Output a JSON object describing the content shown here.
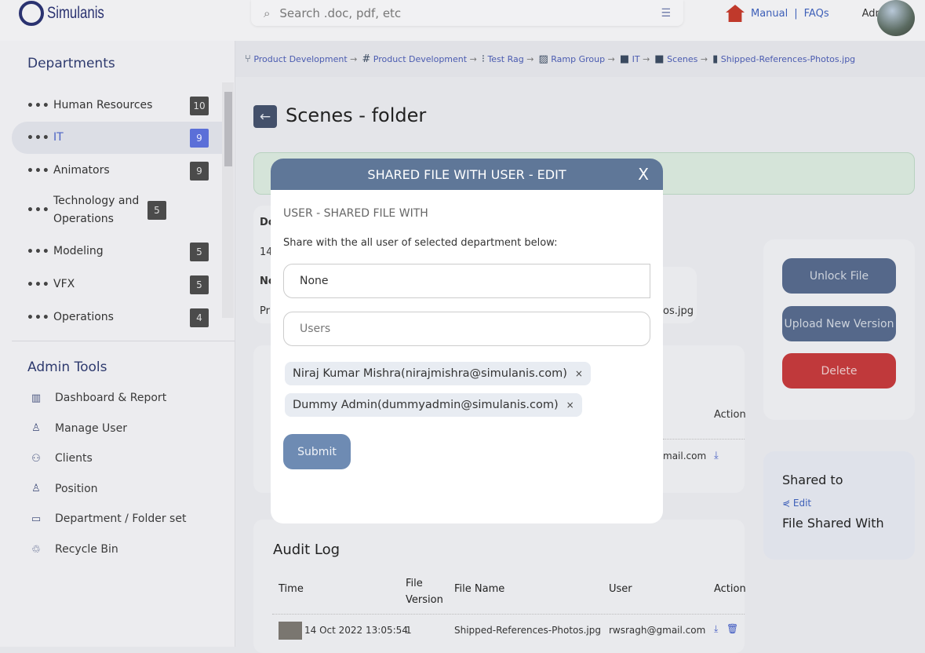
{
  "header": {
    "logo": "Simulanis",
    "search_placeholder": "Search .doc, pdf, etc",
    "manual": "Manual",
    "sep": "|",
    "faqs": "FAQs",
    "user": "Admin"
  },
  "sidebar": {
    "departments_title": "Departments",
    "departments": [
      {
        "label": "Human Resources",
        "count": "10"
      },
      {
        "label": "IT",
        "count": "9",
        "active": true
      },
      {
        "label": "Animators",
        "count": "9"
      },
      {
        "label": "Technology and Operations",
        "count": "5"
      },
      {
        "label": "Modeling",
        "count": "5"
      },
      {
        "label": "VFX",
        "count": "5"
      },
      {
        "label": "Operations",
        "count": "4"
      }
    ],
    "dots": "•••",
    "admin_title": "Admin Tools",
    "tools": [
      {
        "label": "Dashboard & Report",
        "icon": "chart-icon"
      },
      {
        "label": "Manage User",
        "icon": "user-icon"
      },
      {
        "label": "Clients",
        "icon": "users-icon"
      },
      {
        "label": "Position",
        "icon": "user-icon"
      },
      {
        "label": "Department / Folder set",
        "icon": "folder-icon"
      },
      {
        "label": "Recycle Bin",
        "icon": "recycle-icon"
      }
    ]
  },
  "breadcrumb": [
    {
      "label": "Product Development",
      "icon": "branch-icon"
    },
    {
      "label": "Product Development",
      "icon": "hash-icon"
    },
    {
      "label": "Test Rag",
      "icon": "tree-icon"
    },
    {
      "label": "Ramp Group",
      "icon": "image-icon"
    },
    {
      "label": "IT",
      "icon": "folder-icon"
    },
    {
      "label": "Scenes",
      "icon": "folder-icon"
    },
    {
      "label": "Shipped-References-Photos.jpg",
      "icon": "file-icon"
    }
  ],
  "arrow": "→",
  "page": {
    "title": "Scenes - folder"
  },
  "background_fragments": {
    "do": "Do",
    "num": "14",
    "no": "No",
    "pr": "Pr",
    "osjpg": "os.jpg",
    "action": "Action",
    "mail": "mail.com"
  },
  "actions": {
    "unlock": "Unlock File",
    "upload": "Upload New Version",
    "delete": "Delete"
  },
  "shared": {
    "title": "Shared to",
    "edit": "Edit",
    "with": "File Shared With"
  },
  "audit": {
    "title": "Audit Log",
    "headers": [
      "Time",
      "File Version",
      "File Name",
      "User",
      "Action"
    ],
    "rows": [
      {
        "time": "14 Oct 2022 13:05:54",
        "version": "1",
        "file": "Shipped-References-Photos.jpg",
        "user": "rwsragh@gmail.com"
      }
    ]
  },
  "modal": {
    "title": "SHARED FILE WITH USER - EDIT",
    "close": "X",
    "subtitle": "USER - SHARED FILE WITH",
    "description": "Share with the all user of selected department below:",
    "department_value": "None",
    "users_placeholder": "Users",
    "chips": [
      "Niraj Kumar Mishra(nirajmishra@simulanis.com)",
      "Dummy Admin(dummyadmin@simulanis.com)"
    ],
    "chip_remove": "×",
    "submit": "Submit"
  },
  "colors": {
    "modal_header": "#5f7798",
    "submit": "#6e8bb3",
    "delete": "#c0393b",
    "active_badge": "#5b6fd8"
  }
}
